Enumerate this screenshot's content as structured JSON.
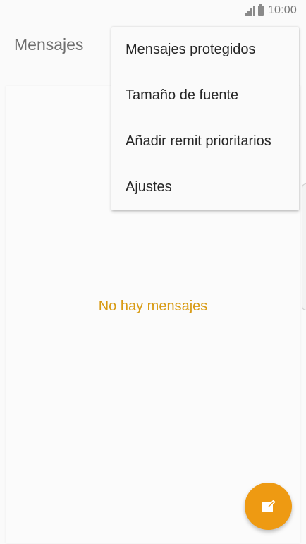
{
  "status_bar": {
    "time": "10:00"
  },
  "header": {
    "title": "Mensajes"
  },
  "overflow_menu": {
    "items": [
      {
        "label": "Mensajes protegidos"
      },
      {
        "label": "Tamaño de fuente"
      },
      {
        "label": "Añadir remit prioritarios"
      },
      {
        "label": "Ajustes"
      }
    ]
  },
  "empty_state": {
    "message": "No hay mensajes"
  },
  "icons": {
    "signal": "signal-icon",
    "battery": "battery-icon",
    "compose": "compose-icon"
  },
  "colors": {
    "accent": "#ee9a12",
    "empty_text": "#d89a12",
    "background": "#fafafa"
  }
}
